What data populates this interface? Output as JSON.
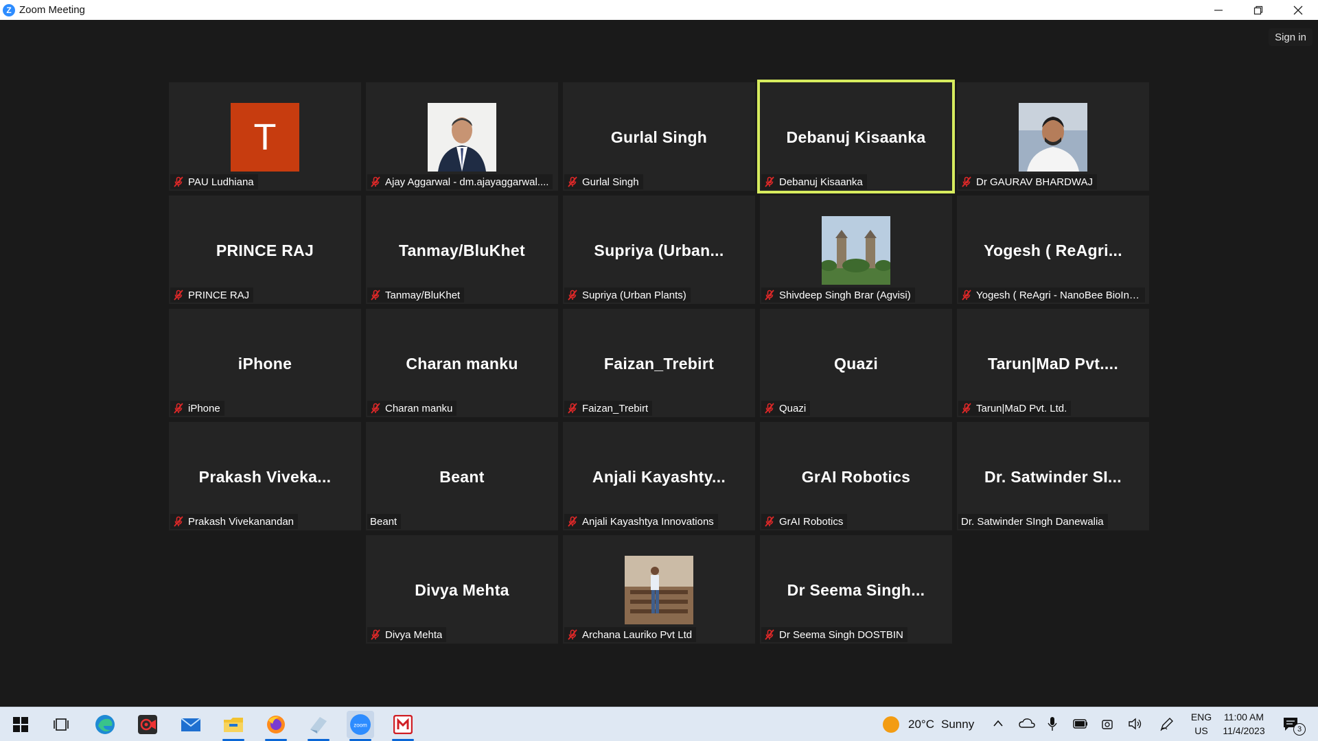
{
  "window": {
    "title": "Zoom Meeting",
    "sign_in": "Sign in"
  },
  "tiles": [
    {
      "big": "",
      "tag": "PAU Ludhiana",
      "muted": true,
      "avatar": "letter",
      "letter": "T"
    },
    {
      "big": "",
      "tag": "Ajay Aggarwal - dm.ajayaggarwal....",
      "muted": true,
      "avatar": "photo-man-suit"
    },
    {
      "big": "Gurlal Singh",
      "tag": "Gurlal Singh",
      "muted": true
    },
    {
      "big": "Debanuj Kisaanka",
      "tag": "Debanuj Kisaanka",
      "muted": true,
      "active": true
    },
    {
      "big": "",
      "tag": "Dr GAURAV BHARDWAJ",
      "muted": true,
      "avatar": "photo-man-white-shirt"
    },
    {
      "big": "PRINCE RAJ",
      "tag": "PRINCE RAJ",
      "muted": true
    },
    {
      "big": "Tanmay/BluKhet",
      "tag": "Tanmay/BluKhet",
      "muted": true
    },
    {
      "big": "Supriya (Urban...",
      "tag": "Supriya (Urban Plants)",
      "muted": true
    },
    {
      "big": "",
      "tag": "Shivdeep Singh Brar (Agvisi)",
      "muted": true,
      "avatar": "photo-monument"
    },
    {
      "big": "Yogesh ( ReAgri...",
      "tag": "Yogesh ( ReAgri - NanoBee BioInn...",
      "muted": true
    },
    {
      "big": "iPhone",
      "tag": "iPhone",
      "muted": true
    },
    {
      "big": "Charan manku",
      "tag": "Charan manku",
      "muted": true
    },
    {
      "big": "Faizan_Trebirt",
      "tag": "Faizan_Trebirt",
      "muted": true
    },
    {
      "big": "Quazi",
      "tag": "Quazi",
      "muted": true
    },
    {
      "big": "Tarun|MaD Pvt....",
      "tag": "Tarun|MaD Pvt. Ltd.",
      "muted": true
    },
    {
      "big": "Prakash Viveka...",
      "tag": "Prakash Vivekanandan",
      "muted": true
    },
    {
      "big": "Beant",
      "tag": "Beant",
      "muted": false
    },
    {
      "big": "Anjali Kayashty...",
      "tag": "Anjali Kayashtya Innovations",
      "muted": true
    },
    {
      "big": "GrAI Robotics",
      "tag": "GrAI Robotics",
      "muted": true
    },
    {
      "big": "Dr. Satwinder SI...",
      "tag": "Dr. Satwinder SIngh Danewalia",
      "muted": false
    },
    {
      "big": "Divya Mehta",
      "tag": "Divya Mehta",
      "muted": true
    },
    {
      "big": "",
      "tag": "Archana Lauriko Pvt Ltd",
      "muted": true,
      "avatar": "photo-woman-standing"
    },
    {
      "big": "Dr Seema Singh...",
      "tag": "Dr Seema Singh DOSTBIN",
      "muted": true
    }
  ],
  "taskbar": {
    "apps": [
      "windows-start-icon",
      "task-view-icon",
      "edge-icon",
      "screen-recorder-icon",
      "mail-icon",
      "file-explorer-icon",
      "firefox-icon",
      "paper-app-icon",
      "zoom-icon",
      "mcafee-icon"
    ],
    "weather_temp": "20°C",
    "weather_text": "Sunny",
    "lang_line1": "ENG",
    "lang_line2": "US",
    "time": "11:00 AM",
    "date": "11/4/2023",
    "notification_count": "3"
  }
}
